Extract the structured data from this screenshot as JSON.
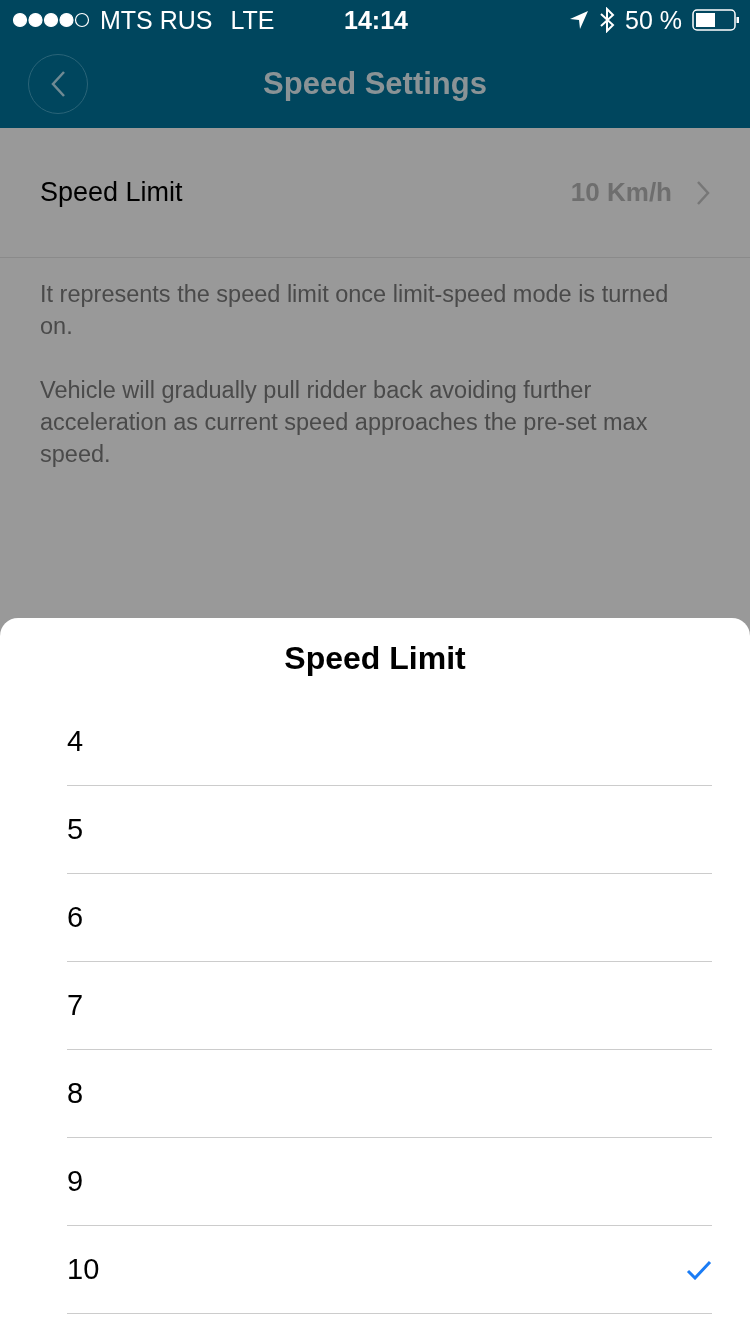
{
  "status_bar": {
    "carrier": "MTS RUS",
    "network": "LTE",
    "time": "14:14",
    "battery": "50 %"
  },
  "nav": {
    "title": "Speed Settings"
  },
  "setting": {
    "label": "Speed Limit",
    "value": "10 Km/h"
  },
  "description": [
    "It represents the speed limit once limit-speed mode is turned on.",
    "Vehicle will gradually pull ridder back avoiding further acceleration as current speed approaches the pre-set max speed."
  ],
  "sheet": {
    "title": "Speed Limit",
    "options": [
      {
        "label": "4",
        "selected": false
      },
      {
        "label": "5",
        "selected": false
      },
      {
        "label": "6",
        "selected": false
      },
      {
        "label": "7",
        "selected": false
      },
      {
        "label": "8",
        "selected": false
      },
      {
        "label": "9",
        "selected": false
      },
      {
        "label": "10",
        "selected": true
      }
    ]
  }
}
